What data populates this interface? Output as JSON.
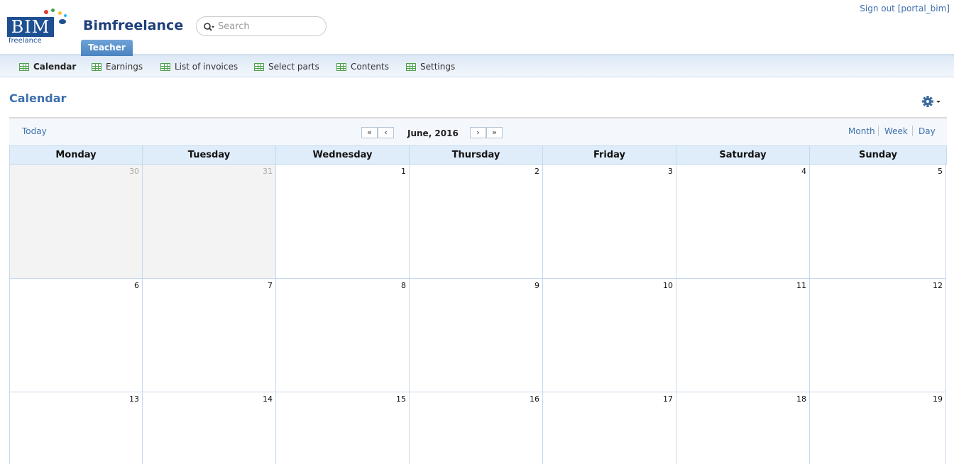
{
  "header": {
    "app_title": "Bimfreelance",
    "logo_text": "BIM",
    "logo_subtext": "freelance",
    "search_placeholder": "Search",
    "role_tab": "Teacher",
    "signout": "Sign out [portal_bim]"
  },
  "nav": {
    "items": [
      {
        "label": "Calendar",
        "icon": "grid-icon",
        "active": true
      },
      {
        "label": "Earnings",
        "icon": "grid-icon"
      },
      {
        "label": "List of invoices",
        "icon": "grid-icon"
      },
      {
        "label": "Select parts",
        "icon": "grid-icon"
      },
      {
        "label": "Contents",
        "icon": "grid-icon"
      },
      {
        "label": "Settings",
        "icon": "grid-icon"
      }
    ]
  },
  "page": {
    "title": "Calendar",
    "settings_icon": "gear-icon"
  },
  "calendar": {
    "today_label": "Today",
    "period": "June, 2016",
    "buttons": {
      "first": "«",
      "prev": "‹",
      "next": "›",
      "last": "»"
    },
    "views": [
      "Month",
      "Week",
      "Day"
    ],
    "weekdays": [
      "Monday",
      "Tuesday",
      "Wednesday",
      "Thursday",
      "Friday",
      "Saturday",
      "Sunday"
    ],
    "weeks": [
      [
        {
          "n": "30",
          "other": true
        },
        {
          "n": "31",
          "other": true
        },
        {
          "n": "1"
        },
        {
          "n": "2"
        },
        {
          "n": "3"
        },
        {
          "n": "4"
        },
        {
          "n": "5"
        }
      ],
      [
        {
          "n": "6"
        },
        {
          "n": "7"
        },
        {
          "n": "8"
        },
        {
          "n": "9"
        },
        {
          "n": "10"
        },
        {
          "n": "11"
        },
        {
          "n": "12"
        }
      ],
      [
        {
          "n": "13"
        },
        {
          "n": "14"
        },
        {
          "n": "15"
        },
        {
          "n": "16"
        },
        {
          "n": "17"
        },
        {
          "n": "18"
        },
        {
          "n": "19"
        }
      ]
    ]
  },
  "colors": {
    "brand": "#1d4f91",
    "link": "#3d6fae",
    "header_bg": "#dfecf9",
    "other_month_bg": "#f3f3f3"
  }
}
